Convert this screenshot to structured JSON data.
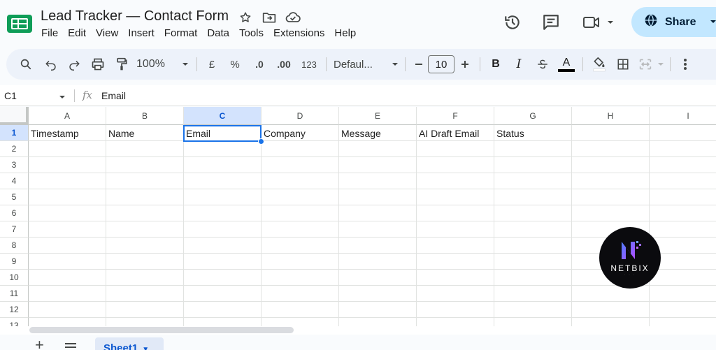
{
  "doc": {
    "title": "Lead Tracker — Contact Form"
  },
  "menu": [
    "File",
    "Edit",
    "View",
    "Insert",
    "Format",
    "Data",
    "Tools",
    "Extensions",
    "Help"
  ],
  "share": {
    "label": "Share"
  },
  "toolbar": {
    "zoom": "100%",
    "currency": "£",
    "percent": "%",
    "decrease_decimal": ".0",
    "increase_decimal": ".00",
    "number_format": "123",
    "font": "Defaul...",
    "font_size": "10",
    "bold": "B",
    "italic": "I",
    "text_color": "A"
  },
  "formula_bar": {
    "cell_ref": "C1",
    "fx": "fx",
    "content": "Email"
  },
  "columns": [
    "A",
    "B",
    "C",
    "D",
    "E",
    "F",
    "G",
    "H",
    "I"
  ],
  "selected_column": "C",
  "rows": [
    "1",
    "2",
    "3",
    "4",
    "5",
    "6",
    "7",
    "8",
    "9",
    "10",
    "11",
    "12",
    "13"
  ],
  "header_row": [
    "Timestamp",
    "Name",
    "Email",
    "Company",
    "Message",
    "AI Draft Email",
    "Status"
  ],
  "sheets": [
    {
      "name": "Sheet1",
      "active": true
    }
  ],
  "badge": {
    "brand": "NETBIX"
  },
  "colors": {
    "accent": "#1a73e8",
    "share_bg": "#c2e7ff",
    "selected_header_bg": "#d3e3fd",
    "logo_green": "#0f9d58"
  }
}
